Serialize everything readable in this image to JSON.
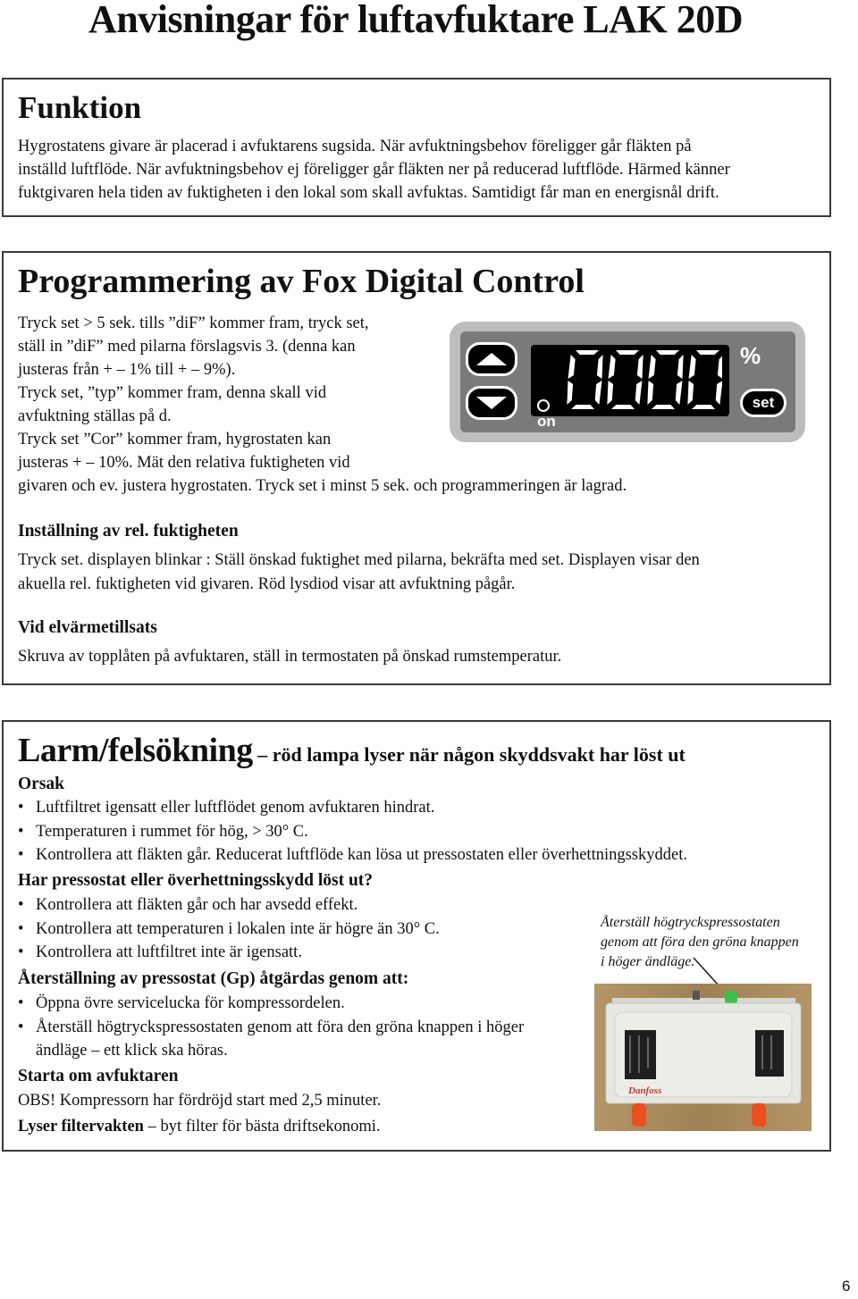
{
  "document": {
    "title": "Anvisningar för luftavfuktare LAK 20D",
    "page_number": "6"
  },
  "funktion": {
    "heading": "Funktion",
    "lines": [
      "Hygrostatens givare är placerad i avfuktarens sugsida. När avfuktningsbehov föreligger går fläkten på",
      "inställd luftflöde. När avfuktningsbehov ej föreligger går fläkten ner på reducerad luftflöde. Härmed känner",
      "fuktgivaren hela tiden av fuktigheten i den lokal som skall avfuktas. Samtidigt får man en energisnål drift."
    ]
  },
  "programmering": {
    "heading": "Programmering av Fox Digital Control",
    "lines": [
      "Tryck set > 5 sek. tills ”diF” kommer fram, tryck set,",
      "ställ in ”diF” med pilarna förslagsvis 3. (denna kan",
      "justeras från + – 1% till + – 9%).",
      "Tryck set, ”typ” kommer fram, denna skall vid",
      "avfuktning ställas på d.",
      "Tryck set ”Cor” kommer fram, hygrostaten kan",
      "justeras + – 10%. Mät den relativa fuktigheten vid",
      "givaren och ev. justera hygrostaten. Tryck set i minst 5 sek. och programmeringen är lagrad."
    ],
    "controller": {
      "display_value": "0000",
      "unit": "%",
      "set_label": "set",
      "led_label": "on",
      "up_icon": "arrow-up-icon",
      "down_icon": "arrow-down-icon",
      "colors": {
        "bezel": "#bdbdbd",
        "panel": "#7a7a7a",
        "display": "#000000",
        "segment": "#ffffff"
      }
    },
    "installning": {
      "heading": "Inställning av rel. fuktigheten",
      "lines": [
        "Tryck set. displayen blinkar : Ställ önskad fuktighet med pilarna, bekräfta med set. Displayen visar den",
        "akuella rel. fuktigheten vid givaren. Röd lysdiod visar att avfuktning pågår."
      ]
    },
    "elvarme": {
      "heading": "Vid elvärmetillsats",
      "text": "Skruva av topplåten på avfuktaren, ställ in termostaten på önskad rumstemperatur."
    }
  },
  "larm": {
    "heading": "Larm/felsökning",
    "subheading": " – röd lampa lyser när någon skyddsvakt har löst ut",
    "orsak": {
      "heading": "Orsak",
      "items": [
        "Luftfiltret igensatt eller luftflödet genom avfuktaren hindrat.",
        "Temperaturen i rummet för hög, > 30° C.",
        "Kontrollera att fläkten går. Reducerat luftflöde kan lösa ut pressostaten eller överhettningsskyddet."
      ]
    },
    "pressostat": {
      "heading": "Har pressostat eller överhettningsskydd löst ut?",
      "items": [
        "Kontrollera att fläkten går och har avsedd effekt.",
        "Kontrollera att temperaturen i lokalen inte är högre än 30° C.",
        "Kontrollera att luftfiltret inte är igensatt."
      ]
    },
    "aterstallning": {
      "heading": "Återställning av pressostat (Gp) åtgärdas genom att:",
      "items": [
        "Öppna övre servicelucka för kompressordelen.",
        "Återställ högtryckspressostaten genom att föra den gröna knappen i höger ändläge – ett klick ska höras."
      ]
    },
    "starta_om": {
      "heading": "Starta om avfuktaren",
      "text": "OBS! Kompressorn har fördröjd start med 2,5 minuter."
    },
    "filtervakt": {
      "bold": "Lyser filtervakten",
      "text": " – byt filter för bästa driftsekonomi."
    },
    "photo": {
      "caption_lines": [
        "Återställ högtryckspressostaten",
        "genom att föra den gröna knappen",
        "i höger ändläge."
      ],
      "brand_label": "Danfoss",
      "description": "pressostat-photo"
    }
  }
}
